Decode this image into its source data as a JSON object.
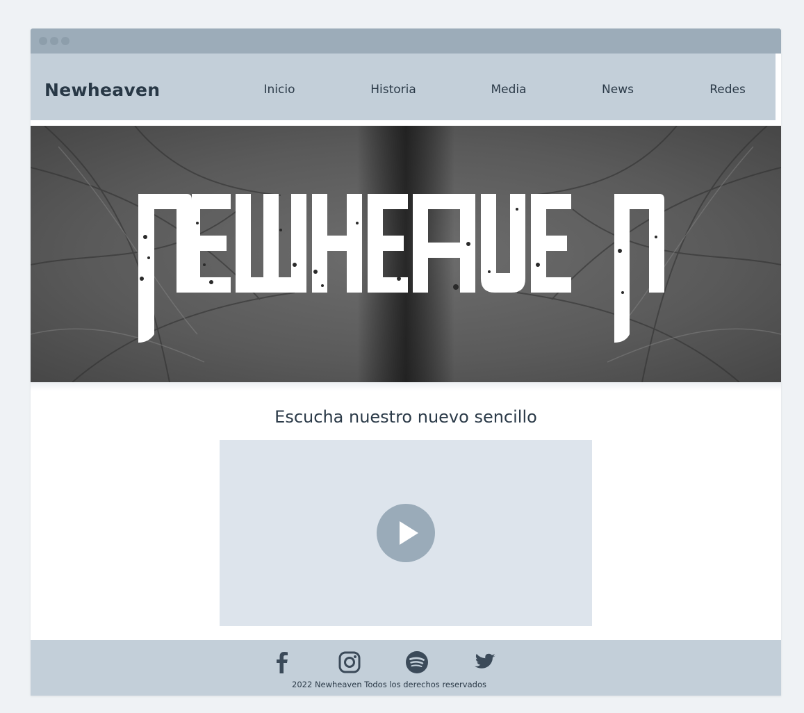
{
  "navbar": {
    "brand": "Newheaven",
    "links": [
      {
        "label": "Inicio"
      },
      {
        "label": "Historia"
      },
      {
        "label": "Media"
      },
      {
        "label": "News"
      },
      {
        "label": "Redes"
      }
    ]
  },
  "hero": {
    "banner_text": "NEWHEAVEN",
    "image": "grayscale-abstract-texture"
  },
  "main": {
    "section_title": "Escucha nuestro nuevo sencillo",
    "player": {
      "icon": "play-icon"
    }
  },
  "footer": {
    "social_icons": [
      "facebook-icon",
      "instagram-icon",
      "spotify-icon",
      "twitter-icon"
    ],
    "copyright": "2022 Newheaven Todos los derechos reservados"
  },
  "colors": {
    "page_bg": "#eff2f5",
    "titlebar": "#9cacb9",
    "navbar": "#c3cfd9",
    "footer": "#c3cfd9",
    "text": "#2b3a48",
    "player_bg": "#dde4ec",
    "play_button": "#9aabb9"
  }
}
